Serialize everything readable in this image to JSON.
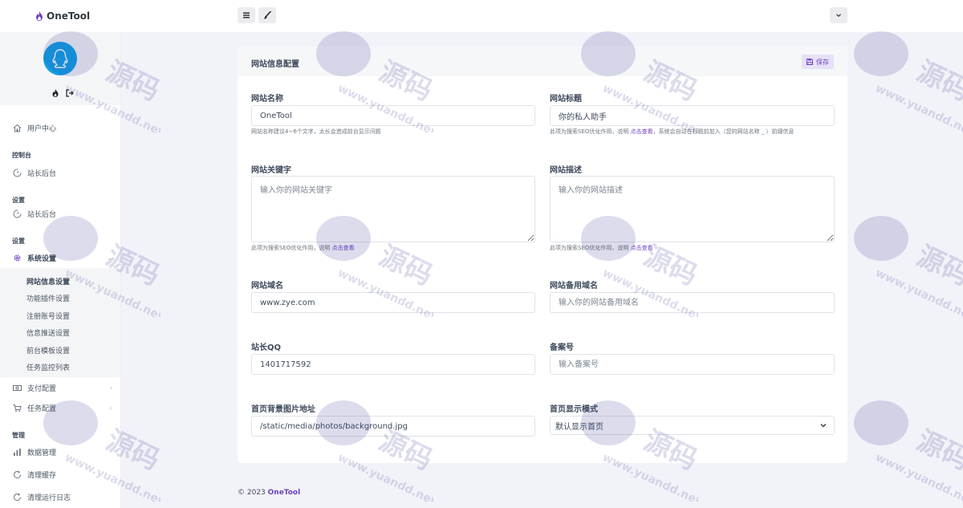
{
  "app": {
    "brand": "OneTool",
    "accent": "#6f42c1",
    "avatar_color": "#11a0e6"
  },
  "topbar": {
    "menu_icon": "menu-icon",
    "brush_icon": "brush-icon",
    "dropdown_icon": "chevron-down-icon"
  },
  "sidebar": {
    "user_center": "用户中心",
    "sections": [
      {
        "heading": "控制台",
        "item": "站长后台"
      },
      {
        "heading": "设置",
        "item": "站长后台"
      },
      {
        "heading": "设置",
        "item": "系统设置"
      }
    ],
    "system_submenu": [
      "网站信息设置",
      "功能插件设置",
      "注册账号设置",
      "信息推送设置",
      "前台模板设置",
      "任务监控列表"
    ],
    "pay_config": "支付配置",
    "task_config": "任务配置",
    "manage_heading": "管理",
    "manage_items": [
      "数据管理",
      "清理缓存",
      "清理运行日志"
    ]
  },
  "card": {
    "title": "网站信息配置",
    "save_label": "保存"
  },
  "form": {
    "site_name": {
      "label": "网站名称",
      "value": "OneTool",
      "help": "网站名称建议4~6个文字，太长会造成前台显示问题"
    },
    "site_title": {
      "label": "网站标题",
      "value": "你的私人助手",
      "help_pre": "此项为搜索SEO优化作用，说明 ",
      "help_link": "点击查看",
      "help_post": "，系统会自动在标题前加入（您的网站名称 _ ）前缀信息"
    },
    "keywords": {
      "label": "网站关键字",
      "placeholder": "输入你的网站关键字",
      "help_pre": "此项为搜索SEO优化作用，说明 ",
      "help_link": "点击查看"
    },
    "description": {
      "label": "网站描述",
      "placeholder": "输入你的网站描述",
      "help_pre": "此项为搜索SEO优化作用，说明 ",
      "help_link": "点击查看"
    },
    "domain": {
      "label": "网站域名",
      "value": "www.zye.com"
    },
    "backup_domain": {
      "label": "网站备用域名",
      "placeholder": "输入你的网站备用域名"
    },
    "qq": {
      "label": "站长QQ",
      "value": "1401717592"
    },
    "icp": {
      "label": "备案号",
      "placeholder": "输入备案号"
    },
    "bg_image": {
      "label": "首页背景图片地址",
      "value": "/static/media/photos/background.jpg"
    },
    "display_mode": {
      "label": "首页显示模式",
      "selected": "默认显示首页"
    }
  },
  "footer": {
    "copyright": "© 2023 ",
    "brand": "OneTool"
  },
  "watermark": {
    "line1": "源码",
    "line2": "www.yuandd.net"
  }
}
